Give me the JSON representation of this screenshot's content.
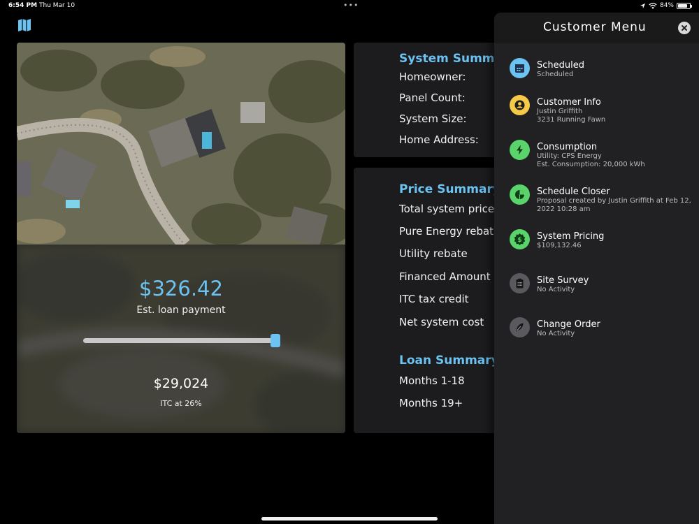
{
  "status_bar": {
    "time": "6:54 PM",
    "date": "Thu Mar 10",
    "battery_text": "84%",
    "battery_level": 0.84
  },
  "toolbar": {
    "map_icon": "map-icon"
  },
  "loan_card": {
    "payment": "$326.42",
    "payment_label": "Est. loan payment",
    "slider_level": 1.0,
    "itc_amount": "$29,024",
    "itc_label": "ITC at 26%"
  },
  "system_summary": {
    "title": "System Summary",
    "rows": [
      {
        "label": "Homeowner:",
        "value": ""
      },
      {
        "label": "Panel Count:",
        "value": ""
      },
      {
        "label": "System Size:",
        "value": ""
      },
      {
        "label": "Home Address:",
        "value": ""
      }
    ]
  },
  "price_summary": {
    "title": "Price Summary",
    "rows": [
      {
        "label": "Total system price",
        "value": ""
      },
      {
        "label": "Pure Energy rebate",
        "value": ""
      },
      {
        "label": "Utility rebate",
        "value": ""
      },
      {
        "label": "Financed Amount",
        "value": ""
      },
      {
        "label": "ITC tax credit",
        "value": ""
      },
      {
        "label": "Net system cost",
        "value": ""
      }
    ]
  },
  "loan_summary": {
    "title": "Loan Summary",
    "rows": [
      {
        "label": "Months 1-18",
        "value": ""
      },
      {
        "label": "Months 19+",
        "value": ""
      }
    ]
  },
  "customer_menu": {
    "title": "Customer Menu",
    "items": [
      {
        "title": "Scheduled",
        "sub": [
          "Scheduled"
        ],
        "icon": "calendar-icon",
        "color": "#6cc2f0"
      },
      {
        "title": "Customer Info",
        "sub": [
          "Justin Griffith",
          "3231 Running Fawn"
        ],
        "icon": "person-icon",
        "color": "#f7c948"
      },
      {
        "title": "Consumption",
        "sub": [
          "Utility: CPS Energy",
          "Est. Consumption: 20,000 kWh"
        ],
        "icon": "lightning-icon",
        "color": "#5ad36a"
      },
      {
        "title": "Schedule Closer",
        "sub": [
          "Proposal created by  Justin Griffith at Feb 12, 2022 10:28 am"
        ],
        "icon": "pie-chart-icon",
        "color": "#5ad36a"
      },
      {
        "title": "System Pricing",
        "sub": [
          "$109,132.46"
        ],
        "icon": "dollar-badge-icon",
        "color": "#5ad36a"
      },
      {
        "title": "Site Survey",
        "sub": [
          "No Activity"
        ],
        "icon": "clipboard-icon",
        "color": "#5a5a5e"
      },
      {
        "title": "Change Order",
        "sub": [
          "No Activity"
        ],
        "icon": "pen-icon",
        "color": "#5a5a5e"
      }
    ]
  }
}
